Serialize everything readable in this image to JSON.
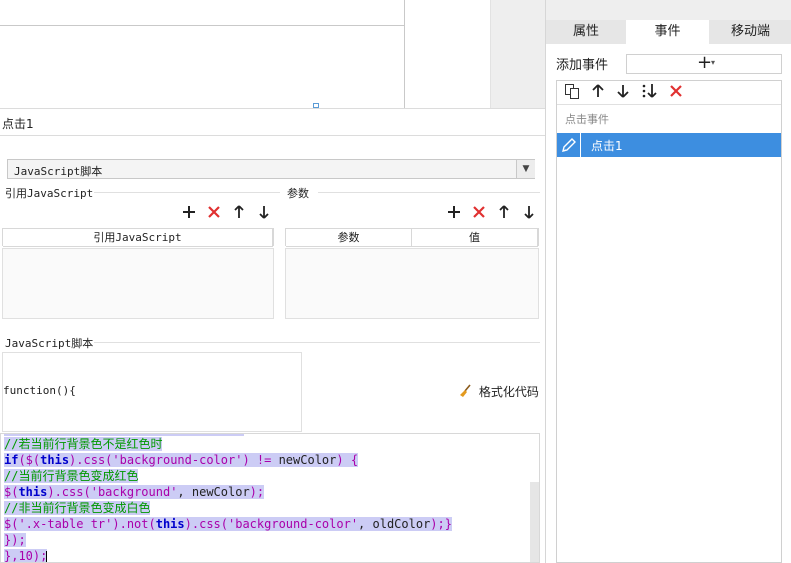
{
  "right_panel": {
    "tabs": [
      {
        "label": "属性",
        "active": false
      },
      {
        "label": "事件",
        "active": true
      },
      {
        "label": "移动端",
        "active": false
      }
    ],
    "add_event_label": "添加事件",
    "add_event_plus": "+",
    "add_event_caret": "▾",
    "toolbar_icons": [
      "copy-icon",
      "arrow-up-icon",
      "arrow-down-icon",
      "move-to-bottom-icon",
      "delete-icon"
    ],
    "event_group_label": "点击事件",
    "events": [
      {
        "label": "点击1",
        "selected": true,
        "icon": "pencil-icon"
      }
    ]
  },
  "editor": {
    "title": "点击1",
    "script_type": "JavaScript脚本",
    "ref_section_label": "引用JavaScript",
    "ref_table_header": "引用JavaScript",
    "param_section_label": "参数",
    "param_table_headers": [
      "参数",
      "值"
    ],
    "script_section_label": "JavaScript脚本",
    "function_signature": "function(){",
    "format_button_label": "格式化代码",
    "code_lines": [
      {
        "text": "",
        "partial": true
      },
      {
        "parts": [
          {
            "t": "//若当前行背景色不是红色时",
            "c": "cm"
          }
        ]
      },
      {
        "parts": [
          {
            "t": "if",
            "c": "kw"
          },
          {
            "t": "($(",
            "c": "pn"
          },
          {
            "t": "this",
            "c": "kw"
          },
          {
            "t": ").css(",
            "c": "pn"
          },
          {
            "t": "'background-color'",
            "c": "st"
          },
          {
            "t": ") != ",
            "c": "pn"
          },
          {
            "t": "newColor",
            "c": "tx"
          },
          {
            "t": ") {",
            "c": "pn"
          }
        ]
      },
      {
        "parts": [
          {
            "t": "//当前行背景色变成红色",
            "c": "cm"
          }
        ]
      },
      {
        "parts": [
          {
            "t": "$(",
            "c": "pn"
          },
          {
            "t": "this",
            "c": "kw"
          },
          {
            "t": ").css(",
            "c": "pn"
          },
          {
            "t": "'background'",
            "c": "st"
          },
          {
            "t": ", ",
            "c": "tx"
          },
          {
            "t": "newColor",
            "c": "tx"
          },
          {
            "t": ");",
            "c": "pn"
          }
        ]
      },
      {
        "parts": [
          {
            "t": "//非当前行背景色变成白色",
            "c": "cm"
          }
        ]
      },
      {
        "parts": [
          {
            "t": "$(",
            "c": "pn"
          },
          {
            "t": "'.x-table tr'",
            "c": "st"
          },
          {
            "t": ").not(",
            "c": "pn"
          },
          {
            "t": "this",
            "c": "kw"
          },
          {
            "t": ").css(",
            "c": "pn"
          },
          {
            "t": "'background-color'",
            "c": "st"
          },
          {
            "t": ", ",
            "c": "tx"
          },
          {
            "t": "oldColor",
            "c": "tx"
          },
          {
            "t": ");}",
            "c": "pn"
          }
        ]
      },
      {
        "parts": [
          {
            "t": "});",
            "c": "pn"
          }
        ]
      },
      {
        "parts": [
          {
            "t": "},10);",
            "c": "pn"
          }
        ]
      }
    ]
  },
  "colors": {
    "selected_row": "#3d8ee0",
    "selection_highlight": "#ccccf5",
    "delete_red": "#e03030",
    "comment_green": "#009900",
    "keyword_blue": "#0000cc",
    "string_purple": "#aa00aa"
  }
}
